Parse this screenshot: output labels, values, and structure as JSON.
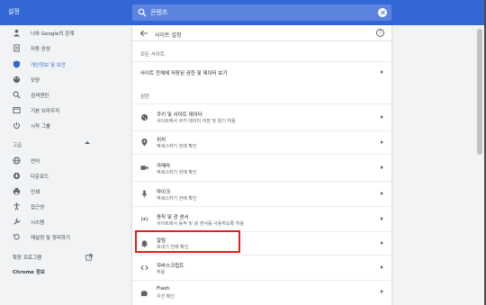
{
  "header": {
    "title": "설정",
    "search_value": "콘텐츠"
  },
  "sidebar": {
    "items": [
      {
        "label": "나와 Google의 관계",
        "icon": "person-icon"
      },
      {
        "label": "자동 완성",
        "icon": "clipboard-icon"
      },
      {
        "label": "개인정보 및 보안",
        "icon": "shield-icon",
        "active": true
      },
      {
        "label": "모양",
        "icon": "palette-icon"
      },
      {
        "label": "검색엔진",
        "icon": "search-icon"
      },
      {
        "label": "기본 브라우저",
        "icon": "browser-icon"
      },
      {
        "label": "시작 그룹",
        "icon": "power-icon"
      }
    ],
    "advanced_label": "고급",
    "advanced_items": [
      {
        "label": "언어",
        "icon": "globe-icon"
      },
      {
        "label": "다운로드",
        "icon": "download-icon"
      },
      {
        "label": "인쇄",
        "icon": "print-icon"
      },
      {
        "label": "접근성",
        "icon": "accessibility-icon"
      },
      {
        "label": "시스템",
        "icon": "wrench-icon"
      },
      {
        "label": "재설정 및 정리하기",
        "icon": "reset-icon"
      }
    ],
    "extensions_label": "확장 프로그램",
    "about_label": "Chrome 정보"
  },
  "panel": {
    "title": "사이트 설정",
    "all_sites_head": "모든 사이트",
    "all_sites_row": "사이트 전체에 저장된 권한 및 데이터 보기",
    "permissions_head": "권한",
    "rows": [
      {
        "title": "쿠키 및 사이트 데이터",
        "sub": "사이트에서 쿠키 데이터 저장 및 읽기 허용",
        "icon": "cookie-icon"
      },
      {
        "title": "위치",
        "sub": "액세스하기 전에 확인",
        "icon": "location-icon"
      },
      {
        "title": "카메라",
        "sub": "액세스하기 전에 확인",
        "icon": "camera-icon"
      },
      {
        "title": "마이크",
        "sub": "액세스하기 전에 확인",
        "icon": "microphone-icon"
      },
      {
        "title": "동작 및 광 센서",
        "sub": "사이트에서 동작 및 광 센서를 사용하도록 허용",
        "icon": "sensor-icon"
      },
      {
        "title": "알림",
        "sub": "보내기 전에 확인",
        "icon": "bell-icon"
      },
      {
        "title": "자바스크립트",
        "sub": "허용",
        "icon": "code-icon"
      },
      {
        "title": "Flash",
        "sub": "우선 확인",
        "icon": "puzzle-icon"
      }
    ]
  },
  "colors": {
    "accent": "#3367d6",
    "highlight": "#e0201b"
  }
}
